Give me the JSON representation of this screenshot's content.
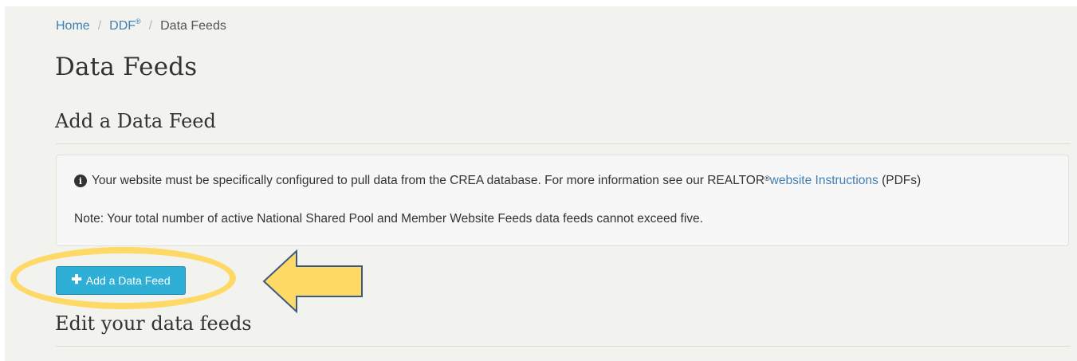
{
  "breadcrumb": {
    "home": "Home",
    "ddf": "DDF",
    "ddf_mark": "®",
    "separator": "/",
    "current": "Data Feeds"
  },
  "page_title": "Data Feeds",
  "add_section": {
    "title": "Add a Data Feed",
    "info": {
      "icon": "info-circle-icon",
      "line1_text": "Your website must be specifically configured to pull data from the CREA database. For more information see our REALTOR",
      "line1_mark": "®",
      "line1_link": "website Instructions",
      "line1_suffix": "(PDFs)",
      "line2_text": "Note: Your total number of active National Shared Pool and Member Website Feeds data feeds cannot exceed five."
    },
    "button_label": "Add a Data Feed",
    "button_icon": "plus-icon"
  },
  "edit_section": {
    "title": "Edit your data feeds"
  },
  "annotation_colors": {
    "highlight": "#ffd966",
    "arrow_fill": "#ffd966",
    "arrow_stroke": "#3b5a80"
  }
}
